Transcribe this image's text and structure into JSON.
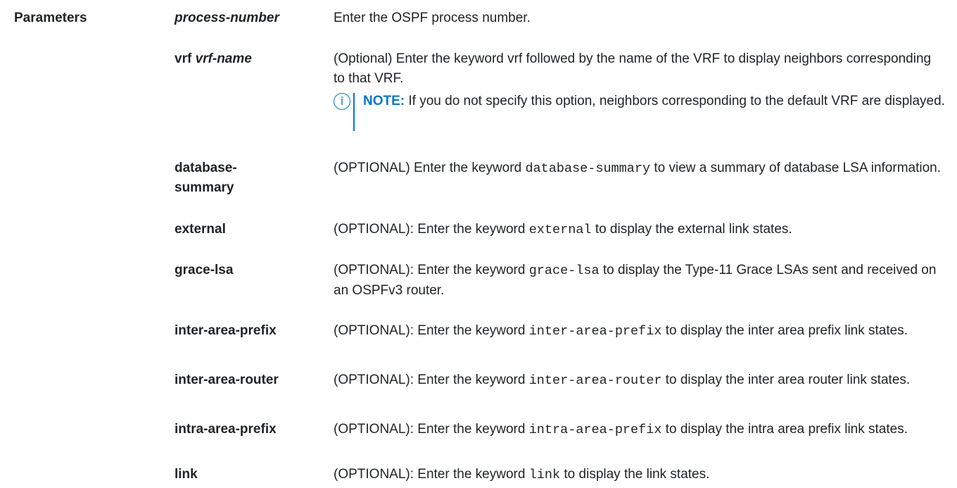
{
  "section": "Parameters",
  "params": [
    {
      "term": "process-number",
      "desc": "Enter the OSPF process number."
    },
    {
      "term_prefix": "vrf",
      "term_italic": "vrf-name",
      "desc": "(Optional) Enter the keyword vrf followed by the name of the VRF to display neighbors corresponding to that VRF.",
      "note_label": "NOTE:",
      "note_text": "If you do not specify this option, neighbors corresponding to the default VRF are displayed."
    },
    {
      "term": "database-summary",
      "desc_pre": "(OPTIONAL) Enter the keyword",
      "keyword": "database-summary",
      "desc_post": "to view a summary of database LSA information."
    },
    {
      "term": "external",
      "desc_pre": "(OPTIONAL): Enter the keyword",
      "keyword": "external",
      "desc_post": "to display the external link states."
    },
    {
      "term": "grace-lsa",
      "desc_pre": "(OPTIONAL): Enter the keyword",
      "keyword": "grace-lsa",
      "desc_post": "to display the Type-11 Grace LSAs sent and received on an OSPFv3 router."
    },
    {
      "term": "inter-area-prefix",
      "desc_pre": "(OPTIONAL): Enter the keyword",
      "keyword": "inter-area-prefix",
      "desc_post": "to display the inter area prefix link states."
    },
    {
      "term": "inter-area-router",
      "desc_pre": "(OPTIONAL): Enter the keyword",
      "keyword": "inter-area-router",
      "desc_post": "to display the inter area router link states."
    },
    {
      "term": "intra-area-prefix",
      "desc_pre": "(OPTIONAL): Enter the keyword",
      "keyword": "intra-area-prefix",
      "desc_post": "to display the intra area prefix link states."
    },
    {
      "term": "link",
      "desc_pre": "(OPTIONAL): Enter the keyword",
      "keyword": "link",
      "desc_post": "to display the link states."
    }
  ]
}
